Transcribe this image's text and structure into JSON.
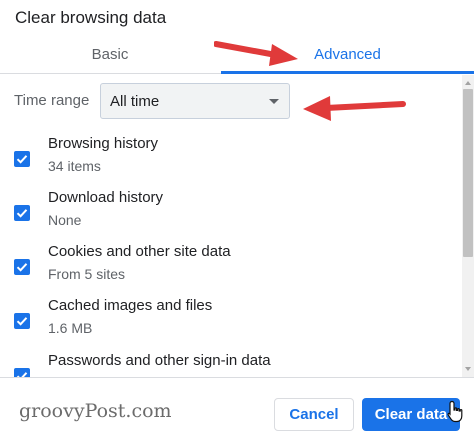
{
  "dialog": {
    "title": "Clear browsing data"
  },
  "tabs": [
    {
      "label": "Basic",
      "selected": false
    },
    {
      "label": "Advanced",
      "selected": true
    }
  ],
  "time_range": {
    "label": "Time range",
    "value": "All time"
  },
  "items": [
    {
      "title": "Browsing history",
      "subtitle": "34 items",
      "checked": true
    },
    {
      "title": "Download history",
      "subtitle": "None",
      "checked": true
    },
    {
      "title": "Cookies and other site data",
      "subtitle": "From 5 sites",
      "checked": true
    },
    {
      "title": "Cached images and files",
      "subtitle": "1.6 MB",
      "checked": true
    },
    {
      "title": "Passwords and other sign-in data",
      "subtitle": "",
      "checked": true
    }
  ],
  "footer": {
    "watermark": "groovyPost.com",
    "cancel_label": "Cancel",
    "clear_label": "Clear data"
  },
  "colors": {
    "accent": "#1a73e8",
    "annotation_arrow": "#e03a3a"
  },
  "icons": {
    "checkbox": "checkmark-icon",
    "dropdown": "caret-down-icon",
    "pointer": "hand-pointer-icon",
    "annotation": "red-arrow-icon"
  }
}
